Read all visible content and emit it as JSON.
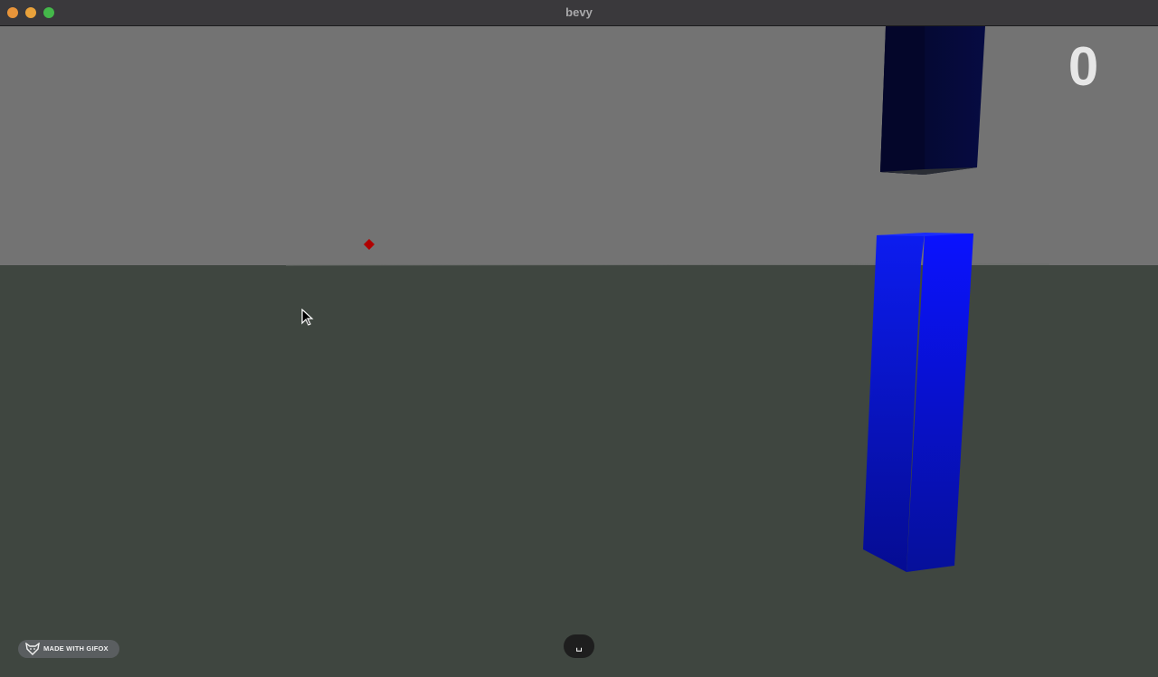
{
  "window": {
    "title": "bevy"
  },
  "hud": {
    "score": "0"
  },
  "overlay": {
    "gifox_label": "MADE WITH GIFOX",
    "key_label": "␣"
  },
  "colors": {
    "sky": "#737373",
    "ground": "#3f4640",
    "pipe_top": "#040730",
    "pipe_bottom": "#0a14f0",
    "bird": "#b00000"
  },
  "icons": [
    "close-light",
    "minimize-light",
    "maximize-light",
    "fox-icon",
    "cursor-icon"
  ]
}
